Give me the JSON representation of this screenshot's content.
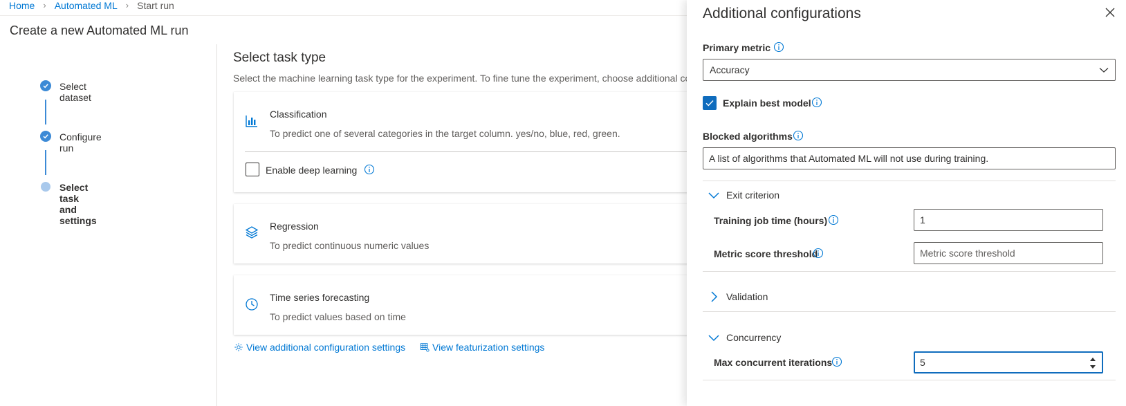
{
  "breadcrumb": {
    "home": "Home",
    "automated_ml": "Automated ML",
    "current": "Start run"
  },
  "page_title": "Create a new Automated ML run",
  "steps": [
    {
      "label": "Select dataset",
      "status": "complete"
    },
    {
      "label": "Configure run",
      "status": "complete"
    },
    {
      "label": "Select task and settings",
      "status": "current"
    }
  ],
  "main": {
    "title": "Select task type",
    "description": "Select the machine learning task type for the experiment. To fine tune the experiment, choose additional configuration settings.",
    "tasks": [
      {
        "title": "Classification",
        "description": "To predict one of several categories in the target column. yes/no, blue, red, green.",
        "icon": "bar-chart-icon"
      },
      {
        "title": "Regression",
        "description": "To predict continuous numeric values",
        "icon": "layers-icon"
      },
      {
        "title": "Time series forecasting",
        "description": "To predict values based on time",
        "icon": "clock-icon"
      }
    ],
    "deep_learning_label": "Enable deep learning",
    "links": {
      "additional_config": "View additional configuration settings",
      "featurization": "View featurization settings"
    }
  },
  "panel": {
    "title": "Additional configurations",
    "primary_metric_label": "Primary metric",
    "primary_metric_value": "Accuracy",
    "explain_best_model_label": "Explain best model",
    "explain_best_model_checked": true,
    "blocked_algorithms_label": "Blocked algorithms",
    "blocked_algorithms_placeholder": "A list of algorithms that Automated ML will not use during training.",
    "exit_criterion": {
      "header": "Exit criterion",
      "training_time_label": "Training job time (hours)",
      "training_time_value": "1",
      "metric_threshold_label": "Metric score threshold",
      "metric_threshold_placeholder": "Metric score threshold"
    },
    "validation_header": "Validation",
    "concurrency": {
      "header": "Concurrency",
      "max_iterations_label": "Max concurrent iterations",
      "max_iterations_value": "5"
    }
  },
  "colors": {
    "accent": "#0078d4",
    "step": "#3c8ad6",
    "checkbox": "#0f6cbd"
  }
}
